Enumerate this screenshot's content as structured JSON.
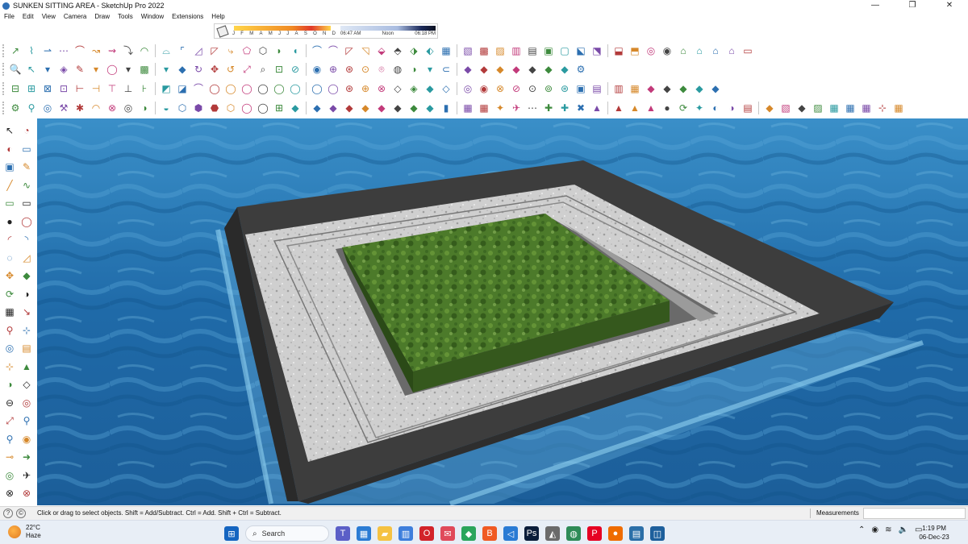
{
  "window": {
    "title": "SUNKEN SITTING AREA - SketchUp Pro 2022",
    "minimize": "—",
    "maximize": "❐",
    "close": "✕"
  },
  "menu": [
    "File",
    "Edit",
    "View",
    "Camera",
    "Draw",
    "Tools",
    "Window",
    "Extensions",
    "Help"
  ],
  "shadow_settings": {
    "months": [
      "J",
      "F",
      "M",
      "A",
      "M",
      "J",
      "J",
      "A",
      "S",
      "O",
      "N",
      "D"
    ],
    "sunrise": "06:47 AM",
    "noon": "Noon",
    "sunset": "06:18 PM"
  },
  "toolbars": {
    "row1": [
      "↗",
      "⌇",
      "⇀",
      "⋯",
      "⌒",
      "↝",
      "⇝",
      "⤵",
      "◠",
      "⌓",
      "⌜",
      "◿",
      "◸",
      "⤷",
      "⬠",
      "⬡",
      "◗",
      "◖",
      "⌒",
      "⌒",
      "◸",
      "◹",
      "⬙",
      "⬘",
      "⬗",
      "⬖",
      "▦",
      "▧",
      "▩",
      "▨",
      "▥",
      "▤",
      "▣",
      "▢",
      "⬕",
      "⬔",
      "⬓",
      "⬒",
      "◎",
      "◉",
      "⌂",
      "⌂",
      "⌂",
      "⌂",
      "▭"
    ],
    "row2": [
      "🔍",
      "↖",
      "▾",
      "◈",
      "✎",
      "▾",
      "◯",
      "▾",
      "▩",
      "▾",
      "◆",
      "↻",
      "✥",
      "↺",
      "⤢",
      "⌕",
      "⊡",
      "⊘",
      "◉",
      "⊕",
      "⊛",
      "⊙",
      "⌾",
      "◍",
      "◑",
      "▾",
      "⊂",
      "◆",
      "◆",
      "◆",
      "◆",
      "◆",
      "◆",
      "◆",
      "⚙"
    ],
    "row3": [
      "⊟",
      "⊞",
      "⊠",
      "⊡",
      "⊢",
      "⊣",
      "⊤",
      "⊥",
      "⊦",
      "◩",
      "◪",
      "⌒",
      "◯",
      "◯",
      "◯",
      "◯",
      "◯",
      "◯",
      "◯",
      "◯",
      "⊛",
      "⊕",
      "⊗",
      "◇",
      "◈",
      "◆",
      "◇",
      "◎",
      "◉",
      "⊗",
      "⊘",
      "⊙",
      "⊚",
      "⊛",
      "▣",
      "▤",
      "▥",
      "▦",
      "◆",
      "◆",
      "◆",
      "◆",
      "◆"
    ],
    "row4": [
      "⚙",
      "⚲",
      "◎",
      "⚒",
      "✱",
      "◠",
      "⊗",
      "◎",
      "◑",
      "◒",
      "⬡",
      "⬢",
      "⬣",
      "⬡",
      "◯",
      "◯",
      "⊞",
      "◆",
      "◆",
      "◆",
      "◆",
      "◆",
      "◆",
      "◆",
      "◆",
      "◆",
      "▮",
      "▦",
      "▦",
      "✦",
      "✈",
      "⋯",
      "✚",
      "✚",
      "✖",
      "▲",
      "▲",
      "▲",
      "▲",
      "●",
      "⟳",
      "✦",
      "◐",
      "◑",
      "▤",
      "◆",
      "▧",
      "◆",
      "▨",
      "▦",
      "▦",
      "▦",
      "⊹",
      "▦"
    ]
  },
  "left_tools": [
    [
      "↖",
      "◔"
    ],
    [
      "◐",
      "▭"
    ],
    [
      "▣",
      "✎"
    ],
    [
      "╱",
      "∿"
    ],
    [
      "▭",
      "▭"
    ],
    [
      "●",
      "◯"
    ],
    [
      "◜",
      "◝"
    ],
    [
      "◌",
      "◿"
    ],
    [
      "✥",
      "◆"
    ],
    [
      "⟳",
      "◑"
    ],
    [
      "▦",
      "↘"
    ],
    [
      "⚲",
      "⊹"
    ],
    [
      "◎",
      "▤"
    ],
    [
      "⊹",
      "▲"
    ],
    [
      "◑",
      "◇"
    ],
    [
      "⊖",
      "◎"
    ],
    [
      "⤢",
      "⚲"
    ],
    [
      "⚲",
      "◉"
    ],
    [
      "⊸",
      "➜"
    ],
    [
      "◎",
      "✈"
    ],
    [
      "⊗",
      "⊗"
    ]
  ],
  "status": {
    "hint": "Click or drag to select objects. Shift = Add/Subtract. Ctrl = Add. Shift + Ctrl = Subtract.",
    "measurements_label": "Measurements",
    "measurements_value": ""
  },
  "taskbar": {
    "temperature": "22°C",
    "condition": "Haze",
    "search_placeholder": "Search",
    "time": "1:19 PM",
    "date": "06-Dec-23",
    "icons": [
      {
        "name": "start-icon",
        "glyph": "⊞",
        "color": "#1565c0"
      },
      {
        "name": "teams-icon",
        "glyph": "T",
        "color": "#5b5fc7"
      },
      {
        "name": "widgets-icon",
        "glyph": "▦",
        "color": "#2a7bd4"
      },
      {
        "name": "file-explorer-icon",
        "glyph": "▰",
        "color": "#f5c242"
      },
      {
        "name": "store-icon",
        "glyph": "▥",
        "color": "#3d7edc"
      },
      {
        "name": "opera-icon",
        "glyph": "O",
        "color": "#d2232a"
      },
      {
        "name": "chat-icon",
        "glyph": "✉",
        "color": "#e04a5a"
      },
      {
        "name": "green-app-icon",
        "glyph": "◆",
        "color": "#2aa55c"
      },
      {
        "name": "brave-icon",
        "glyph": "B",
        "color": "#f05a24"
      },
      {
        "name": "vscode-icon",
        "glyph": "◁",
        "color": "#2a7bd4"
      },
      {
        "name": "photoshop-icon",
        "glyph": "Ps",
        "color": "#0a1d3a"
      },
      {
        "name": "sketchup-red-icon",
        "glyph": "◭",
        "color": "#6a6a6a"
      },
      {
        "name": "chrome-icon",
        "glyph": "◍",
        "color": "#2e8b57"
      },
      {
        "name": "pinterest-icon",
        "glyph": "P",
        "color": "#e60023"
      },
      {
        "name": "orange-app-icon",
        "glyph": "●",
        "color": "#ef6c00"
      },
      {
        "name": "layout-icon",
        "glyph": "▤",
        "color": "#2b6fa8"
      },
      {
        "name": "sketchup-icon",
        "glyph": "◫",
        "color": "#1d5f9c"
      }
    ]
  }
}
